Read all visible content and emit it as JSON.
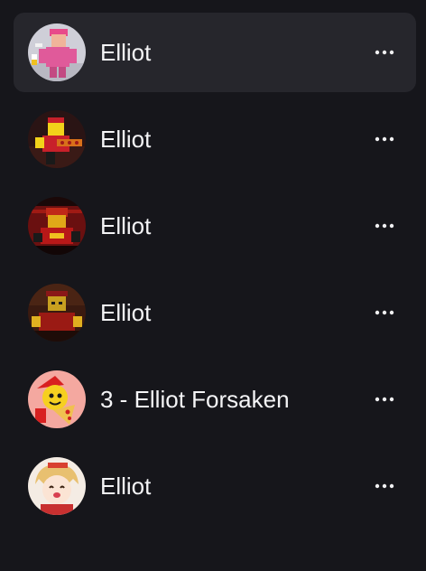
{
  "characters": [
    {
      "name": "Elliot",
      "active": true,
      "avatar_icon": "pink-roblox-avatar-icon",
      "more_icon": "more-horizontal-icon"
    },
    {
      "name": "Elliot",
      "active": false,
      "avatar_icon": "pizza-roblox-avatar-icon",
      "more_icon": "more-horizontal-icon"
    },
    {
      "name": "Elliot",
      "active": false,
      "avatar_icon": "red-roblox-avatar-icon",
      "more_icon": "more-horizontal-icon"
    },
    {
      "name": "Elliot",
      "active": false,
      "avatar_icon": "dark-roblox-avatar-icon",
      "more_icon": "more-horizontal-icon"
    },
    {
      "name": "3 - Elliot Forsaken",
      "active": false,
      "avatar_icon": "cartoon-pizza-avatar-icon",
      "more_icon": "more-horizontal-icon"
    },
    {
      "name": "Elliot",
      "active": false,
      "avatar_icon": "anime-avatar-icon",
      "more_icon": "more-horizontal-icon"
    }
  ],
  "colors": {
    "background": "#16161b",
    "active_row": "#26262c",
    "text": "#f4f4f6"
  }
}
